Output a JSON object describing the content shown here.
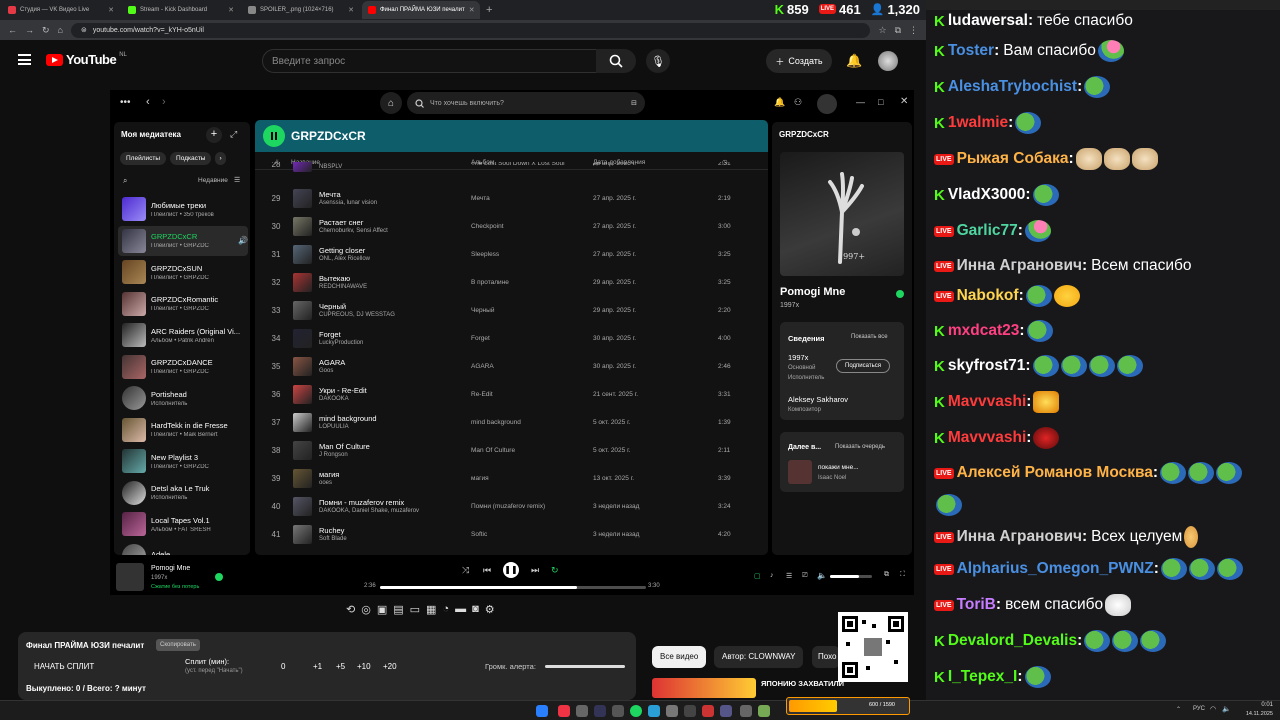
{
  "tabs": [
    {
      "label": "Студия — VK Видео Live",
      "color": "#e63946"
    },
    {
      "label": "Stream - Kick Dashboard",
      "color": "#53fc18"
    },
    {
      "label": "SPOILER_.png (1024×716)",
      "color": "#888888"
    },
    {
      "label": "Финал ПРАЙМА ЮЗИ печалит",
      "color": "#ff0000"
    }
  ],
  "counters": {
    "kick": "859",
    "vk": "461",
    "twitch": "1,320"
  },
  "address": {
    "url": "youtube.com/watch?v=_kYH-o5nUil"
  },
  "youtube": {
    "logo": "YouTube",
    "region": "NL",
    "search_placeholder": "Введите запрос",
    "create": "Создать"
  },
  "spotify": {
    "search_placeholder": "Что хочешь включить?",
    "library_title": "Моя медиатека",
    "filters": [
      "Плейлисты",
      "Подкасты"
    ],
    "sort": "Недавние",
    "library": [
      {
        "title": "Любимые треки",
        "sub": "Плейлист • 350 треков",
        "c1": "#4c2ad1",
        "c2": "#9b8cf6",
        "icon": "♥"
      },
      {
        "title": "GRPZDCxCR",
        "sub": "Плейлист • GRPZDC",
        "c1": "#334",
        "c2": "#889",
        "green": true
      },
      {
        "title": "GRPZDCxSUN",
        "sub": "Плейлист • GRPZDC",
        "c1": "#642",
        "c2": "#a85"
      },
      {
        "title": "GRPZDCxRomantic",
        "sub": "Плейлист • GRPZDC",
        "c1": "#533",
        "c2": "#caa"
      },
      {
        "title": "ARC Raiders (Original Vi...",
        "sub": "Альбом • Patrik Andrén",
        "c1": "#222",
        "c2": "#bbb"
      },
      {
        "title": "GRPZDCxDANCE",
        "sub": "Плейлист • GRPZDC",
        "c1": "#433",
        "c2": "#a66"
      },
      {
        "title": "Portishead",
        "sub": "Исполнитель",
        "c1": "#333",
        "c2": "#999",
        "round": true
      },
      {
        "title": "HardTekk in die Fresse",
        "sub": "Плейлист • Maik Bernert",
        "c1": "#653",
        "c2": "#dba"
      },
      {
        "title": "New Playlist 3",
        "sub": "Плейлист • GRPZDC",
        "c1": "#233",
        "c2": "#6aa"
      },
      {
        "title": "Detsl aka Le Truk",
        "sub": "Исполнитель",
        "c1": "#222",
        "c2": "#ddd",
        "round": true
      },
      {
        "title": "Local Tapes Vol.1",
        "sub": "Альбом • FAT SRESH",
        "c1": "#524",
        "c2": "#b69"
      },
      {
        "title": "Adele",
        "sub": "",
        "c1": "#444",
        "c2": "#aaa",
        "round": true
      }
    ],
    "playlist_title": "GRPZDCxCR",
    "columns": {
      "num": "#",
      "title": "Название",
      "album": "Альбом",
      "date": "Дата добавления"
    },
    "tracks": [
      {
        "n": "28",
        "title": "",
        "artist": "NBSPLV",
        "album": "The Lost Soul Down X Lost Soul",
        "date": "26 апр. 2025 г.",
        "dur": "2:31",
        "c": "#8a2be2"
      },
      {
        "n": "29",
        "title": "Мечта",
        "artist": "Asenssia, lunar vision",
        "album": "Мечта",
        "date": "27 апр. 2025 г.",
        "dur": "2:19",
        "c": "#445"
      },
      {
        "n": "30",
        "title": "Растает снег",
        "artist": "Chernoburkv, Sensi Affect",
        "album": "Checkpoint",
        "date": "27 апр. 2025 г.",
        "dur": "3:00",
        "c": "#776"
      },
      {
        "n": "31",
        "title": "Getting closer",
        "artist": "ONL, Alex Ricellow",
        "album": "Sleepless",
        "date": "27 апр. 2025 г.",
        "dur": "3:25",
        "c": "#567"
      },
      {
        "n": "32",
        "title": "Вытекаю",
        "artist": "REDCHINAWAVE",
        "album": "В проталине",
        "date": "29 апр. 2025 г.",
        "dur": "3:25",
        "c": "#a33"
      },
      {
        "n": "33",
        "title": "Черный",
        "artist": "CUPREOUS, DJ WESSTAG",
        "album": "Черный",
        "date": "29 апр. 2025 г.",
        "dur": "2:20",
        "c": "#666"
      },
      {
        "n": "34",
        "title": "Forget",
        "artist": "LuckyProduction",
        "album": "Forget",
        "date": "30 апр. 2025 г.",
        "dur": "4:00",
        "c": "#223"
      },
      {
        "n": "35",
        "title": "AGARA",
        "artist": "Goos",
        "album": "AGARA",
        "date": "30 апр. 2025 г.",
        "dur": "2:46",
        "c": "#854"
      },
      {
        "n": "36",
        "title": "Укри - Re-Edit",
        "artist": "DAKOOKA",
        "album": "Re-Edit",
        "date": "21 сент. 2025 г.",
        "dur": "3:31",
        "c": "#c44"
      },
      {
        "n": "37",
        "title": "mind background",
        "artist": "LOPUULIA",
        "album": "mind background",
        "date": "5 окт. 2025 г.",
        "dur": "1:39",
        "c": "#ccc"
      },
      {
        "n": "38",
        "title": "Man Of Culture",
        "artist": "J Rongson",
        "album": "Man Of Culture",
        "date": "5 окт. 2025 г.",
        "dur": "2:11",
        "c": "#444"
      },
      {
        "n": "39",
        "title": "магия",
        "artist": "ooes",
        "album": "магия",
        "date": "13 окт. 2025 г.",
        "dur": "3:39",
        "c": "#653"
      },
      {
        "n": "40",
        "title": "Помни - muzaferov remix",
        "artist": "DAKOOKA, Daniel Shake, muzaferov",
        "album": "Помни (muzaferov remix)",
        "date": "3 недели назад",
        "dur": "3:24",
        "c": "#556"
      },
      {
        "n": "41",
        "title": "Ruchey",
        "artist": "Soft Blade",
        "album": "Softic",
        "date": "3 недели назад",
        "dur": "4:20",
        "c": "#777"
      }
    ],
    "right": {
      "title": "GRPZDCxCR",
      "song": "Pomogi Mne",
      "artist": "1997x",
      "about_title": "Сведения",
      "show_all": "Показать все",
      "credit1_name": "1997x",
      "credit1_role1": "Основной",
      "credit1_role2": "Исполнитель",
      "follow": "Подписаться",
      "credit2_name": "Aleksey Sakharov",
      "credit2_role": "Композитор",
      "next_title": "Далее в...",
      "show_queue": "Показать очередь",
      "next_song": "покажи мне...",
      "next_artist": "Isaac Noel"
    },
    "player": {
      "song": "Pomogi Mne",
      "artist": "1997x",
      "status": "Сжатие без потерь",
      "elapsed": "2:36",
      "total": "3:30",
      "progress": 0.74,
      "volume": 0.7
    }
  },
  "info": {
    "title": "Финал ПРАЙМА ЮЗИ печалит",
    "badge": "Скопировать",
    "start_split": "НАЧАТЬ СПЛИТ",
    "split_label": "Сплит (мин):",
    "split_hint": "(уст. перед \"Начать\")",
    "split_value": "0",
    "increments": [
      "+1",
      "+5",
      "+10",
      "+20"
    ],
    "alert_label": "Громк. алерта:",
    "paid": "Выкуплено: 0 / Всего: ? минут"
  },
  "yt_side": {
    "chips": [
      "Все видео",
      "Автор: CLOWNWAY",
      "Похо"
    ],
    "video_title": "ЯПОНИЮ ЗАХВАТИЛИ"
  },
  "chat": [
    {
      "platform": "kick",
      "user": "ludawersal",
      "color": "#ffffff",
      "msg": "тебе спасибо",
      "emotes": []
    },
    {
      "platform": "kick",
      "user": "Toster",
      "color": "#4a90e2",
      "msg": "Вам спасибо",
      "emotes": [
        "pink"
      ]
    },
    {
      "platform": "kick",
      "user": "AleshaTrybochist",
      "color": "#4a90e2",
      "msg": "",
      "emotes": [
        "peepo"
      ]
    },
    {
      "platform": "kick",
      "user": "1walmie",
      "color": "#ff3b3b",
      "msg": "",
      "emotes": [
        "peepo"
      ]
    },
    {
      "platform": "vk",
      "user": "Рыжая Собака",
      "color": "#ffb347",
      "msg": "",
      "emotes": [
        "cat",
        "cat",
        "cat"
      ]
    },
    {
      "platform": "kick",
      "user": "VladX3000",
      "color": "#ffffff",
      "msg": "",
      "emotes": [
        "peepo"
      ]
    },
    {
      "platform": "vk",
      "user": "Garlic77",
      "color": "#4fd6a0",
      "msg": "",
      "emotes": [
        "pink"
      ]
    },
    {
      "platform": "vk",
      "user": "Инна Агранович",
      "color": "#d0d0d0",
      "msg": "Всем спасибо",
      "emotes": []
    },
    {
      "platform": "vk",
      "user": "Nabokof",
      "color": "#ffd54f",
      "msg": "",
      "emotes": [
        "peepo",
        "duck"
      ]
    },
    {
      "platform": "kick",
      "user": "mxdcat23",
      "color": "#ff4081",
      "msg": "",
      "emotes": [
        "peepo"
      ]
    },
    {
      "platform": "kick",
      "user": "skyfrost71",
      "color": "#ffffff",
      "msg": "",
      "emotes": [
        "peepo",
        "peepo",
        "peepo",
        "peepo"
      ]
    },
    {
      "platform": "kick",
      "user": "Mavvvashi",
      "color": "#ff3b3b",
      "msg": "",
      "emotes": [
        "fire"
      ]
    },
    {
      "platform": "kick",
      "user": "Mavvvashi",
      "color": "#ff3b3b",
      "msg": "",
      "emotes": [
        "red"
      ]
    },
    {
      "platform": "vk",
      "user": "Алексей Романов Москва",
      "color": "#ffb347",
      "msg": "",
      "emotes": [
        "peepo",
        "peepo",
        "peepo"
      ]
    },
    {
      "platform": "",
      "user": "",
      "color": "#ffffff",
      "msg": "",
      "emotes": [
        "peepo"
      ]
    },
    {
      "platform": "vk",
      "user": "Инна Агранович",
      "color": "#d0d0d0",
      "msg": "Всех целуем",
      "emotes": [
        "hand"
      ]
    },
    {
      "platform": "vk",
      "user": "Alpharius_Omegon_PWNZ",
      "color": "#4a90e2",
      "msg": "",
      "emotes": [
        "peepo",
        "peepo",
        "peepo"
      ]
    },
    {
      "platform": "vk",
      "user": "ToriB",
      "color": "#c77dff",
      "msg": "всем спасибо",
      "emotes": [
        "heart"
      ]
    },
    {
      "platform": "kick",
      "user": "Devalord_Devalis",
      "color": "#53fc18",
      "msg": "",
      "emotes": [
        "peepo",
        "peepo",
        "peepo"
      ]
    },
    {
      "platform": "kick",
      "user": "I_Tepex_I",
      "color": "#53fc18",
      "msg": "",
      "emotes": [
        "peepo"
      ]
    }
  ],
  "taskbar": {
    "lang": "РУС",
    "time": "0:01",
    "date": "14.11.2025",
    "progress_text": "600 / 1590"
  }
}
